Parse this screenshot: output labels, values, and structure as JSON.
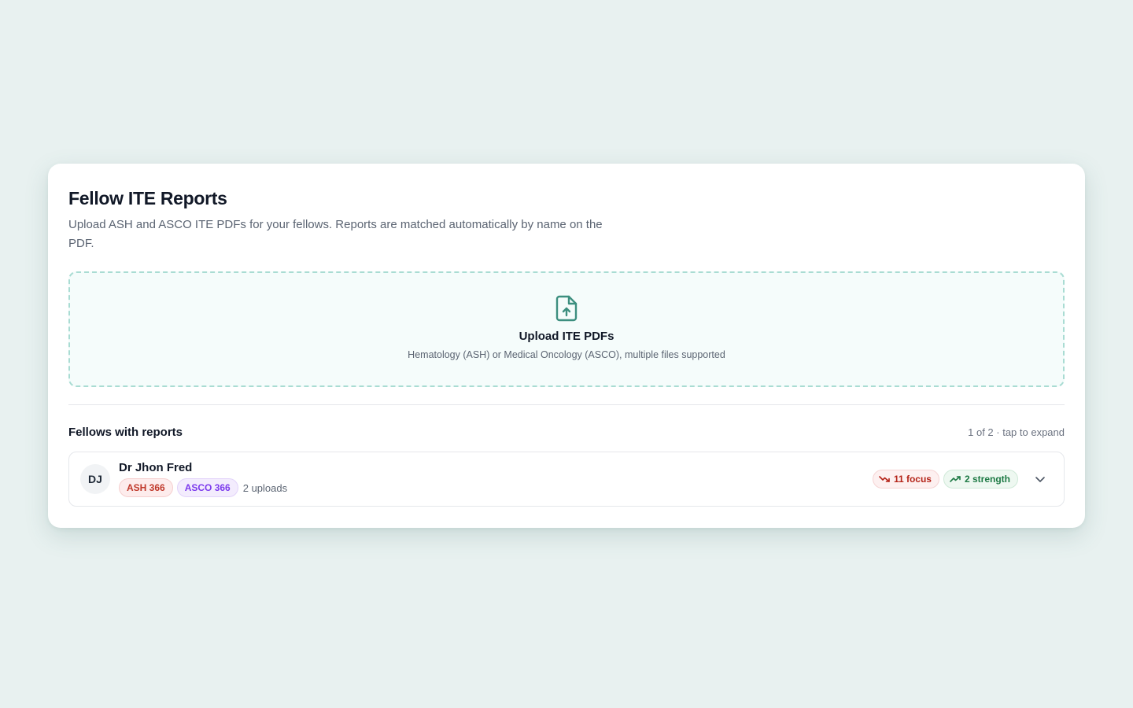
{
  "header": {
    "title": "Fellow ITE Reports",
    "subtitle": "Upload ASH and ASCO ITE PDFs for your fellows. Reports are matched automatically by name on the PDF."
  },
  "upload": {
    "icon": "file-upload-icon",
    "title": "Upload ITE PDFs",
    "hint": "Hematology (ASH) or Medical Oncology (ASCO), multiple files supported"
  },
  "fellows": {
    "section_title": "Fellows with reports",
    "meta": "1 of 2 · tap to expand",
    "items": [
      {
        "initials": "DJ",
        "name": "Dr Jhon Fred",
        "ash_badge": "ASH 366",
        "asco_badge": "ASCO 366",
        "uploads": "2 uploads",
        "focus": "11 focus",
        "strength": "2 strength"
      }
    ]
  },
  "colors": {
    "accent": "#3d8f7f",
    "background": "#e8f1f0",
    "focus": "#b42318",
    "strength": "#1e7a45"
  }
}
